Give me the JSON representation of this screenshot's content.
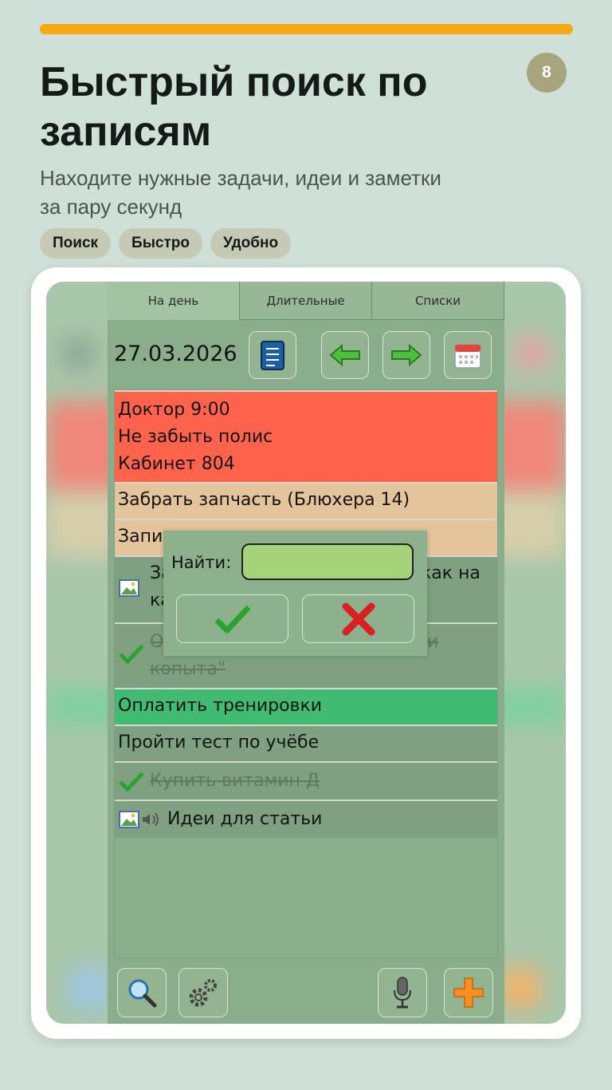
{
  "step_badge": "8",
  "header": {
    "title": "Быстрый поиск по записям",
    "subtitle": "Находите нужные задачи, идеи и заметки за пару секунд"
  },
  "chips": [
    "Поиск",
    "Быстро",
    "Удобно"
  ],
  "app": {
    "tabs": [
      "На день",
      "Длительные",
      "Списки"
    ],
    "active_tab": "На день",
    "date": "27.03.2026",
    "toolbar_icons": [
      "notes-icon",
      "arrow-left-icon",
      "arrow-right-icon",
      "calendar-icon"
    ],
    "items": [
      {
        "lines": [
          "Доктор 9:00",
          "Не забыть полис",
          "Кабинет 804"
        ],
        "color": "#ff634b"
      },
      {
        "lines": [
          "Забрать запчасть (Блюхера 14)"
        ],
        "color": "#e4c49a"
      },
      {
        "lines": [
          "Запи"
        ],
        "color": "#e4c49a"
      },
      {
        "lines": [
          "За",
          "ка"
        ],
        "trailing": "как на",
        "color": "#7fa181",
        "icon": "image-icon"
      },
      {
        "lines": [
          "О",
          "копыта\""
        ],
        "trailing": "и",
        "color": "#7fa181",
        "done": true
      },
      {
        "lines": [
          "Оплатить тренировки"
        ],
        "color": "#42bb72"
      },
      {
        "lines": [
          "Пройти тест по учёбе"
        ],
        "color": "#7fa181"
      },
      {
        "lines": [
          "Купить витамин Д"
        ],
        "color": "#7fa181",
        "done": true
      },
      {
        "lines": [
          "Идеи для статьи"
        ],
        "color": "#7fa181",
        "icon": "image-sound-icon"
      }
    ],
    "search_dialog": {
      "label": "Найти:",
      "value": ""
    },
    "bottom_icons": [
      "search-icon",
      "settings-icon",
      "microphone-icon",
      "add-icon"
    ]
  },
  "colors": {
    "accent": "#f5a80f",
    "background": "#cfe0d8",
    "app_bg": "#8aae8c"
  }
}
